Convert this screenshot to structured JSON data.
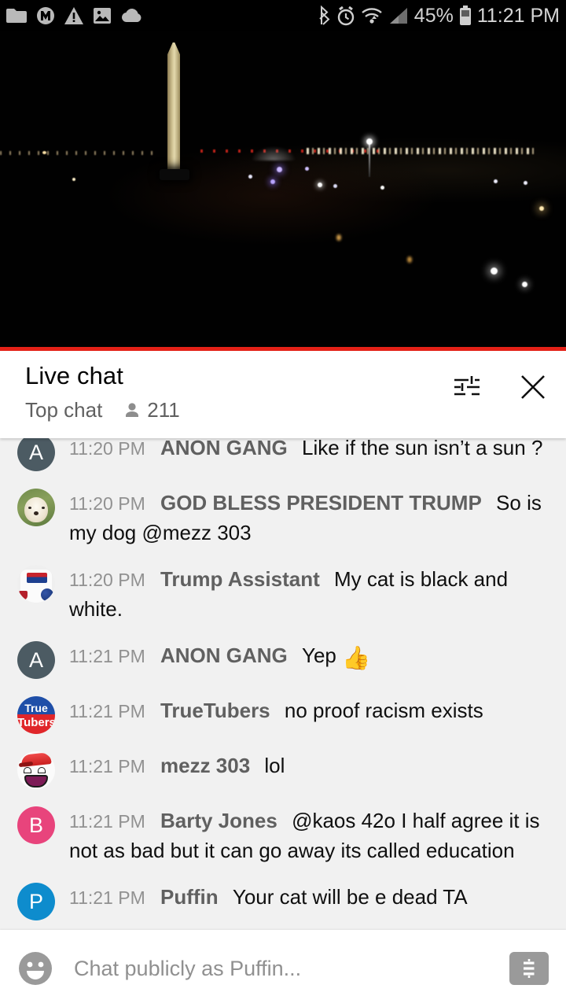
{
  "statusbar": {
    "left_icons": [
      "folder-icon",
      "m-badge-icon",
      "warning-triangle-icon",
      "image-icon",
      "cloud-icon"
    ],
    "right_icons": [
      "bluetooth-icon",
      "alarm-clock-icon",
      "wifi-icon",
      "cell-signal-icon",
      "battery-icon"
    ],
    "battery_percent": "45%",
    "clock": "11:21 PM"
  },
  "video": {
    "scene_description": "Night skyline with Washington Monument",
    "progress_color": "#e52117"
  },
  "chat": {
    "title": "Live chat",
    "mode": "Top chat",
    "viewer_count": "211",
    "settings_icon": "tune-icon",
    "close_icon": "close-icon",
    "messages": [
      {
        "time": "11:20 PM",
        "author": "ANON GANG",
        "text": "Like if the sun isn’t a sun ?",
        "avatar_kind": "letter",
        "avatar_letter": "A",
        "avatar_color": "#4c5b63",
        "clipped": true
      },
      {
        "time": "11:20 PM",
        "author": "GOD BLESS PRESIDENT TRUMP",
        "text": "So is my dog @mezz 303",
        "avatar_kind": "photo-dog",
        "avatar_letter": "",
        "avatar_color": "#7d944f",
        "clipped": false
      },
      {
        "time": "11:20 PM",
        "author": "Trump Assistant",
        "text": "My cat is black and white.",
        "avatar_kind": "photo-shirt",
        "avatar_letter": "",
        "avatar_color": "#efefef",
        "clipped": false
      },
      {
        "time": "11:21 PM",
        "author": "ANON GANG",
        "text": "Yep",
        "emoji": "👍",
        "avatar_kind": "letter",
        "avatar_letter": "A",
        "avatar_color": "#4c5b63",
        "clipped": false
      },
      {
        "time": "11:21 PM",
        "author": "TrueTubers",
        "text": "no proof racism exists",
        "avatar_kind": "logo-truetubers",
        "avatar_letter": "",
        "avatar_color": "#1f4fa8",
        "clipped": false
      },
      {
        "time": "11:21 PM",
        "author": "mezz 303",
        "text": "lol",
        "avatar_kind": "meme-face",
        "avatar_letter": "",
        "avatar_color": "#fbfbfb",
        "clipped": false
      },
      {
        "time": "11:21 PM",
        "author": "Barty Jones",
        "text": "@kaos 42o I half agree it is not as bad but it can go away its called education",
        "avatar_kind": "letter",
        "avatar_letter": "B",
        "avatar_color": "#e8447c",
        "clipped": false
      },
      {
        "time": "11:21 PM",
        "author": "Puffin",
        "text": "Your cat will be e dead TA",
        "avatar_kind": "letter",
        "avatar_letter": "P",
        "avatar_color": "#0e8ccd",
        "clipped": false
      }
    ]
  },
  "input_bar": {
    "emoji_icon": "emoji-smile-icon",
    "placeholder": "Chat publicly as Puffin...",
    "value": "",
    "superchat_icon": "dollar-sign-icon"
  },
  "avatar_logo_text": {
    "truetubers_top": "True",
    "truetubers_bottom": "Tubers"
  }
}
